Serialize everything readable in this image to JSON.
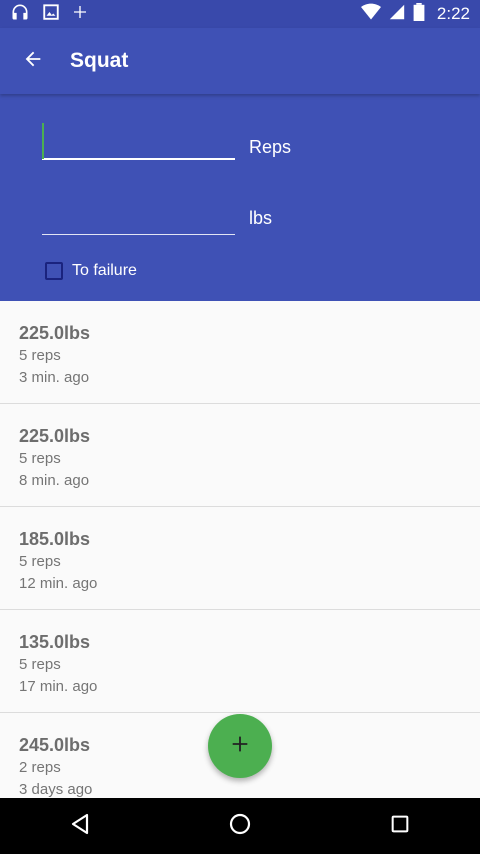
{
  "status_bar": {
    "time": "2:22",
    "icons_left": [
      "headphones-icon",
      "image-icon",
      "plus-icon"
    ],
    "icons_right": [
      "wifi-icon",
      "signal-icon",
      "battery-icon"
    ]
  },
  "app_bar": {
    "title": "Squat",
    "back_icon": "arrow-back-icon"
  },
  "form": {
    "reps": {
      "value": "",
      "unit_label": "Reps",
      "focused": true
    },
    "weight": {
      "value": "",
      "unit_label": "lbs"
    },
    "to_failure": {
      "label": "To failure",
      "checked": false
    }
  },
  "sets": [
    {
      "weight": "225.0lbs",
      "reps": "5 reps",
      "time": "3 min. ago"
    },
    {
      "weight": "225.0lbs",
      "reps": "5 reps",
      "time": "8 min. ago"
    },
    {
      "weight": "185.0lbs",
      "reps": "5 reps",
      "time": "12 min. ago"
    },
    {
      "weight": "135.0lbs",
      "reps": "5 reps",
      "time": "17 min. ago"
    },
    {
      "weight": "245.0lbs",
      "reps": "2 reps",
      "time": "3 days ago"
    }
  ],
  "fab": {
    "icon": "add-icon"
  },
  "nav_bar": {
    "icons": [
      "back-nav-icon",
      "home-nav-icon",
      "recents-nav-icon"
    ]
  },
  "colors": {
    "primary": "#3f51b5",
    "primary_dark": "#3949ab",
    "accent": "#4caf50"
  }
}
